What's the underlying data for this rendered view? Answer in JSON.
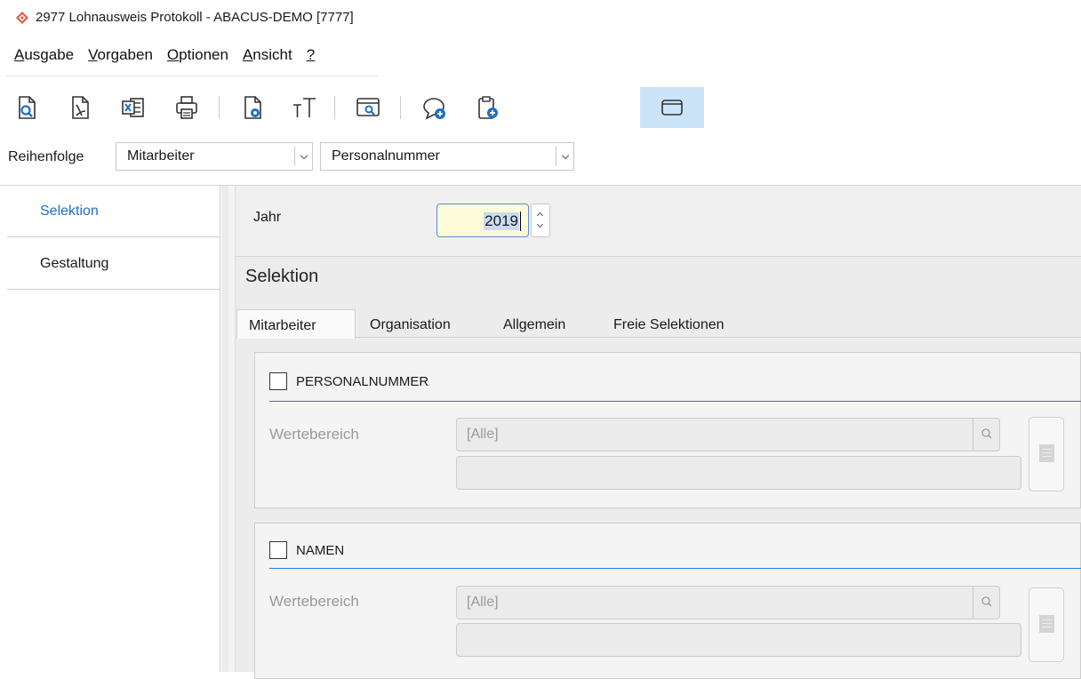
{
  "window": {
    "title": "2977 Lohnausweis Protokoll - ABACUS-DEMO [7777]"
  },
  "menu": [
    {
      "label": "Ausgabe",
      "mnemonic": "A"
    },
    {
      "label": "Vorgaben",
      "mnemonic": "V"
    },
    {
      "label": "Optionen",
      "mnemonic": "O"
    },
    {
      "label": "Ansicht",
      "mnemonic": "A"
    },
    {
      "label": "?",
      "mnemonic": "?"
    }
  ],
  "toolbar": {
    "icons": [
      "preview-icon",
      "pdf-icon",
      "excel-icon",
      "print-icon",
      "page-settings-icon",
      "font-size-icon",
      "window-preview-icon",
      "comment-add-icon",
      "clipboard-add-icon",
      "window-icon"
    ],
    "accent": "#1f6fc5"
  },
  "order": {
    "label": "Reihenfolge",
    "first": "Mitarbeiter",
    "second": "Personalnummer"
  },
  "nav": {
    "items": [
      {
        "label": "Selektion",
        "active": true
      },
      {
        "label": "Gestaltung",
        "active": false
      }
    ]
  },
  "year": {
    "label": "Jahr",
    "value": "2019"
  },
  "selection": {
    "heading": "Selektion",
    "tabs": [
      "Mitarbeiter",
      "Organisation",
      "Allgemein",
      "Freie Selektionen"
    ],
    "groups": [
      {
        "title": "PERSONALNUMMER",
        "range_label": "Wertebereich",
        "range_value": "[Alle]",
        "checked": false
      },
      {
        "title": "NAMEN",
        "range_label": "Wertebereich",
        "range_value": "[Alle]",
        "checked": false
      }
    ]
  }
}
